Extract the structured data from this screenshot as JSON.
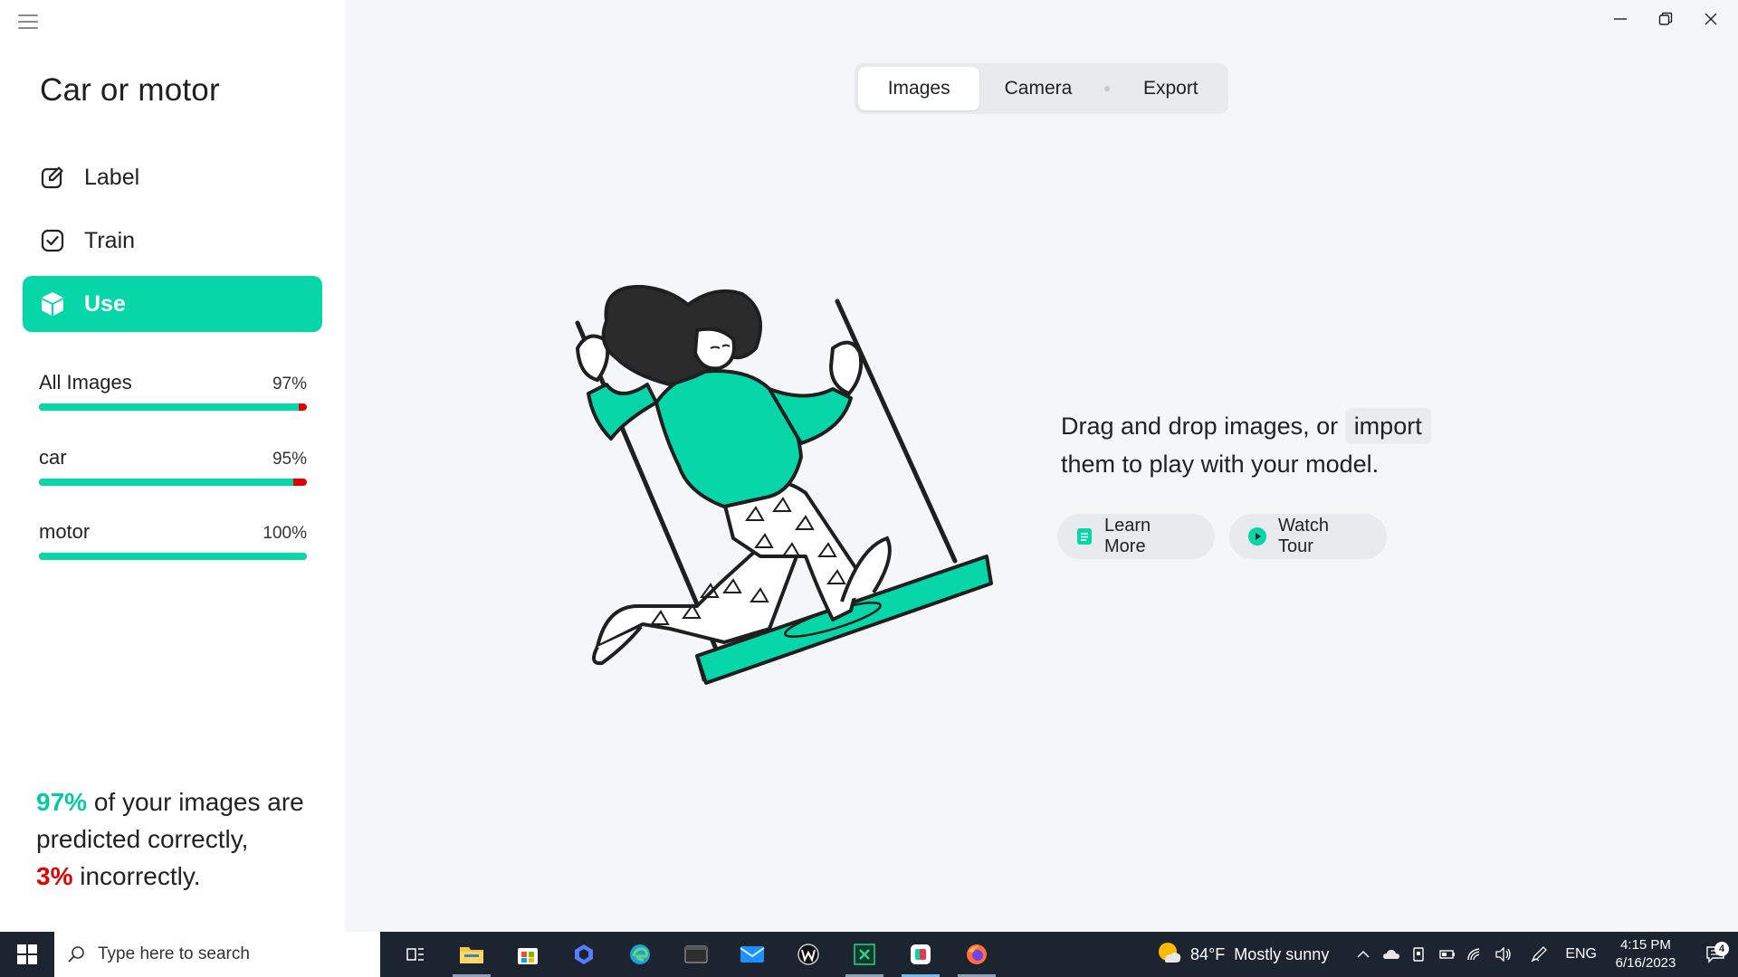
{
  "app": {
    "project_title": "Car or motor"
  },
  "nav": {
    "items": [
      {
        "label": "Label",
        "icon": "pencil-square-icon"
      },
      {
        "label": "Train",
        "icon": "check-square-icon"
      },
      {
        "label": "Use",
        "icon": "cube-icon",
        "active": true
      }
    ]
  },
  "stats": [
    {
      "name": "All Images",
      "percent_label": "97%",
      "correct_fraction": 0.97
    },
    {
      "name": "car",
      "percent_label": "95%",
      "correct_fraction": 0.95
    },
    {
      "name": "motor",
      "percent_label": "100%",
      "correct_fraction": 1.0
    }
  ],
  "summary": {
    "correct_pct": "97%",
    "text1": " of your images are predicted correctly,",
    "incorrect_pct": "3%",
    "text2": " incorrectly."
  },
  "tabs": [
    {
      "label": "Images",
      "selected": true
    },
    {
      "label": "Camera"
    },
    {
      "label": "Export"
    }
  ],
  "dropzone": {
    "text_before": "Drag and drop images, or",
    "import_label": "import",
    "text_after": "them to play with your model.",
    "learn_more_label": "Learn More",
    "watch_tour_label": "Watch Tour"
  },
  "taskbar": {
    "search_placeholder": "Type here to search",
    "weather_temp": "84°F",
    "weather_desc": "Mostly sunny",
    "language": "ENG",
    "time": "4:15 PM",
    "date": "6/16/2023",
    "notification_count": "4"
  },
  "colors": {
    "accent": "#06d6a8",
    "error": "#e00000",
    "taskbar": "#1c2430"
  }
}
